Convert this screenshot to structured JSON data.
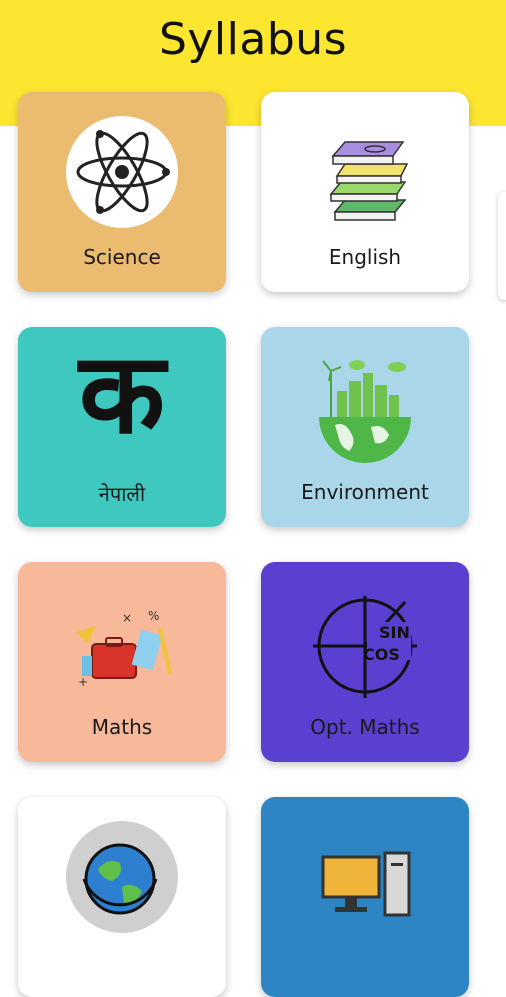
{
  "header": {
    "title": "Syllabus",
    "bg_color": "#fce630"
  },
  "cards": [
    {
      "label": "Science",
      "bg_color": "#ebbb6f",
      "icon": "atom-icon"
    },
    {
      "label": "English",
      "bg_color": "#ffffff",
      "icon": "books-icon"
    },
    {
      "label": "नेपाली",
      "bg_color": "#3ec8c0",
      "icon": "devanagari-ka-icon"
    },
    {
      "label": "Environment",
      "bg_color": "#a9d6e9",
      "icon": "green-city-globe-icon"
    },
    {
      "label": "Maths",
      "bg_color": "#f8b89a",
      "icon": "math-supplies-icon"
    },
    {
      "label": "Opt. Maths",
      "bg_color": "#5a3fd0",
      "icon": "trigonometry-icon"
    },
    {
      "label": "",
      "bg_color": "#ffffff",
      "icon": "globe-icon"
    },
    {
      "label": "",
      "bg_color": "#2e85c4",
      "icon": "computer-icon"
    }
  ],
  "glyphs": {
    "devanagari_ka": "क",
    "trig_sin": "SIN",
    "trig_cos": "COS"
  }
}
